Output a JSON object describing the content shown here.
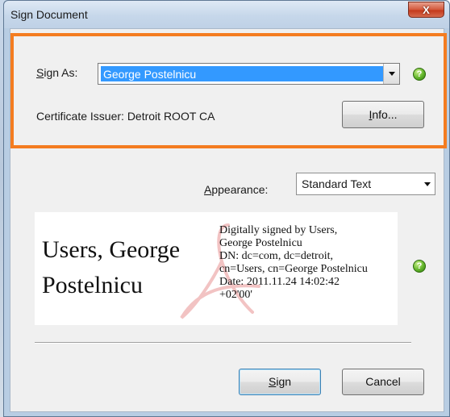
{
  "window": {
    "title": "Sign Document",
    "close_glyph": "X"
  },
  "sign_as": {
    "label_underlined": "S",
    "label_rest": "ign As:",
    "selected_value": "George Postelnicu"
  },
  "certificate": {
    "issuer_text": "Certificate Issuer: Detroit ROOT CA"
  },
  "info_button": {
    "label_underlined": "I",
    "label_rest": "nfo..."
  },
  "appearance": {
    "label_underlined": "A",
    "label_rest": "ppearance:",
    "selected_value": "Standard Text"
  },
  "signature_preview": {
    "name_line1": "Users, George",
    "name_line2": "Postelnicu",
    "details": "Digitally signed by Users,\nGeorge Postelnicu\nDN: dc=com, dc=detroit,\ncn=Users, cn=George Postelnicu\nDate: 2011.11.24 14:02:42\n+02'00'"
  },
  "help_icon_glyph": "?",
  "buttons": {
    "sign_underlined": "S",
    "sign_rest": "ign",
    "cancel": "Cancel"
  },
  "colors": {
    "highlight": "#f47c20",
    "selection": "#3399ff",
    "help_green": "#63b52b"
  }
}
